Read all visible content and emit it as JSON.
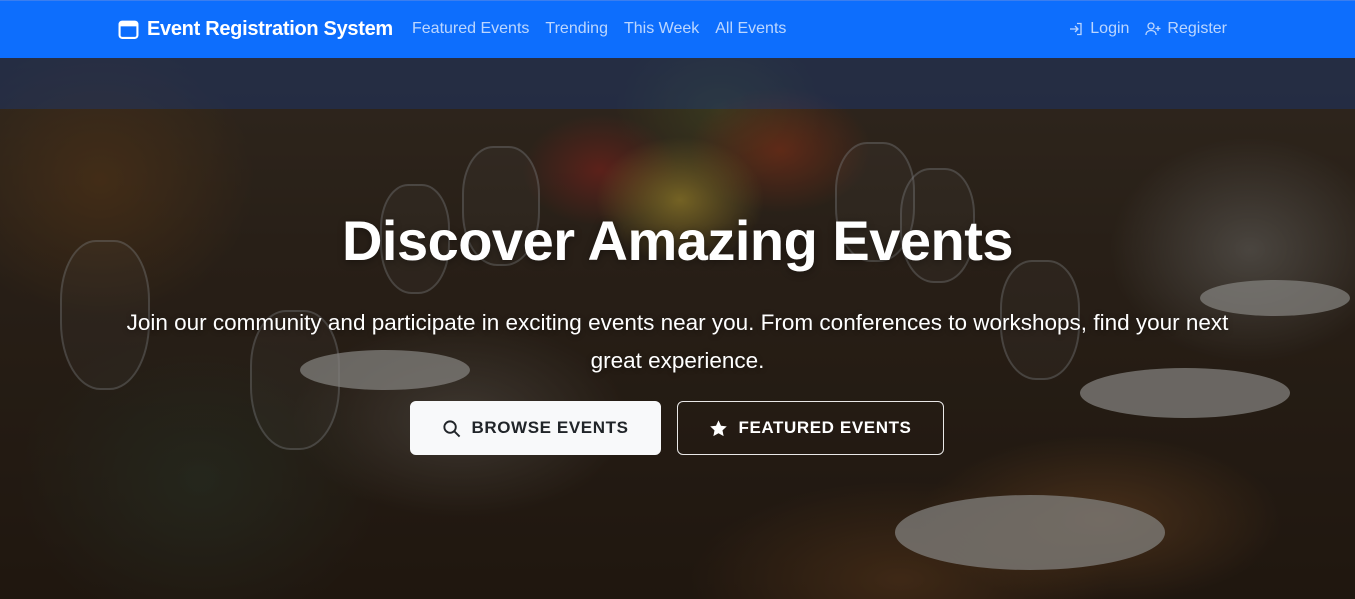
{
  "brand": {
    "name": "Event Registration System",
    "icon": "calendar-icon"
  },
  "nav": {
    "links": [
      {
        "label": "Featured Events"
      },
      {
        "label": "Trending"
      },
      {
        "label": "This Week"
      },
      {
        "label": "All Events"
      }
    ],
    "login": {
      "label": "Login",
      "icon": "login-icon"
    },
    "register": {
      "label": "Register",
      "icon": "register-icon"
    }
  },
  "hero": {
    "title": "Discover Amazing Events",
    "subtitle": "Join our community and participate in exciting events near you. From conferences to workshops, find your next great experience.",
    "buttons": {
      "browse": {
        "label": "BROWSE EVENTS",
        "icon": "search-icon"
      },
      "featured": {
        "label": "FEATURED EVENTS",
        "icon": "star-icon"
      }
    }
  },
  "colors": {
    "navbar": "#0d6efd",
    "nav_link": "rgba(255,255,255,0.72)",
    "button_light": "#f8f9fa",
    "text_dark": "#212529"
  }
}
